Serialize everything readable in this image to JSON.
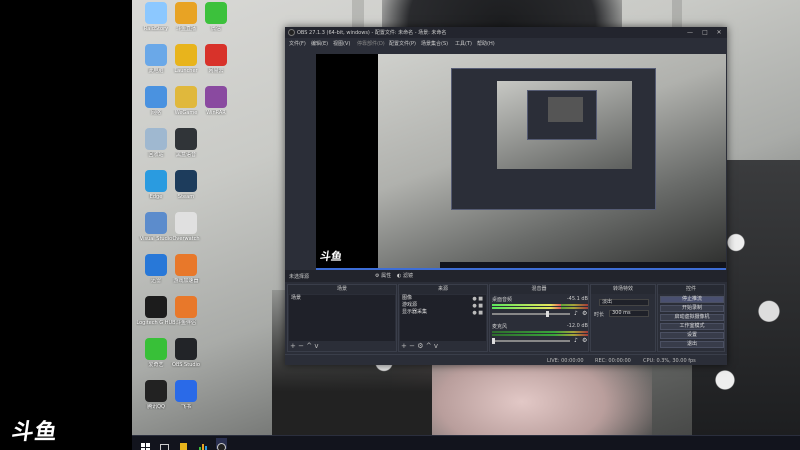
{
  "watermark": {
    "logo_text": "斗鱼"
  },
  "desktop": {
    "icons": [
      {
        "label": "RaidStory",
        "color": "#8cc8ff",
        "col": 0,
        "row": 0
      },
      {
        "label": "斗鱼直播",
        "color": "#e8a324",
        "col": 1,
        "row": 0
      },
      {
        "label": "微信",
        "color": "#3cc13c",
        "col": 2,
        "row": 0
      },
      {
        "label": "此电脑",
        "color": "#6aa8e8",
        "col": 0,
        "row": 1
      },
      {
        "label": "Launcher",
        "color": "#e8b41c",
        "col": 1,
        "row": 1
      },
      {
        "label": "网易云",
        "color": "#d8322a",
        "col": 2,
        "row": 1
      },
      {
        "label": "网络",
        "color": "#4a92e0",
        "col": 0,
        "row": 2
      },
      {
        "label": "WeGame",
        "color": "#e0b83c",
        "col": 1,
        "row": 2
      },
      {
        "label": "WinRAR",
        "color": "#8a4aa0",
        "col": 2,
        "row": 2
      },
      {
        "label": "回收站",
        "color": "#9fb8d0",
        "col": 0,
        "row": 3
      },
      {
        "label": "黑盒语音",
        "color": "#303438",
        "col": 1,
        "row": 3
      },
      {
        "label": "Edge",
        "color": "#2a9be0",
        "col": 0,
        "row": 4
      },
      {
        "label": "Steam",
        "color": "#1d3c5c",
        "col": 1,
        "row": 4
      },
      {
        "label": "Visual Studio",
        "color": "#5c8ccc",
        "col": 0,
        "row": 5
      },
      {
        "label": "Overwatch",
        "color": "#e0e0e0",
        "col": 1,
        "row": 5
      },
      {
        "label": "迅雷",
        "color": "#2878d8",
        "col": 0,
        "row": 6
      },
      {
        "label": "游戏加速器",
        "color": "#e8782a",
        "col": 1,
        "row": 6
      },
      {
        "label": "Logitech G HUB",
        "color": "#1c1c1c",
        "col": 0,
        "row": 7
      },
      {
        "label": "斗鱼伴侣",
        "color": "#e8782a",
        "col": 1,
        "row": 7
      },
      {
        "label": "爱奇艺",
        "color": "#38c038",
        "col": 0,
        "row": 8
      },
      {
        "label": "OBS Studio",
        "color": "#222428",
        "col": 1,
        "row": 8
      },
      {
        "label": "腾讯QQ",
        "color": "#222222",
        "col": 0,
        "row": 9
      },
      {
        "label": "飞书",
        "color": "#2a6ae8",
        "col": 1,
        "row": 9
      }
    ]
  },
  "taskbar": {
    "icons": [
      "windows-icon",
      "task-view-icon",
      "launcher-icon",
      "chart-icon",
      "obs-icon"
    ],
    "clock": ""
  },
  "obs": {
    "title": "OBS 27.1.3 (64-bit, windows) - 配置文件: 未命名 - 场景: 未命名",
    "window_buttons": {
      "minimize": "—",
      "maximize": "□",
      "close": "✕"
    },
    "menu": [
      "文件(F)",
      "编辑(E)",
      "视图(V)",
      "停靠部件(D)",
      "配置文件(P)",
      "场景集合(S)",
      "工具(T)",
      "帮助(H)"
    ],
    "preview_logo": "斗鱼",
    "scene_header": {
      "label": "未选择源",
      "properties": "属性",
      "filters": "滤镜"
    },
    "docks": {
      "scenes": {
        "title": "场景",
        "items": [
          "场景"
        ]
      },
      "sources": {
        "title": "来源",
        "items": [
          "图像",
          "游戏源",
          "显示器采集"
        ]
      },
      "mixer": {
        "title": "混音器",
        "tracks": [
          {
            "name": "桌面音频",
            "db": "-45.1 dB",
            "level": 0.72
          },
          {
            "name": "麦克风",
            "db": "-12.0 dB",
            "level": 0.8
          }
        ]
      },
      "transitions": {
        "title": "转场特效",
        "type": "淡出",
        "duration_label": "时长",
        "duration": "300 ms"
      },
      "controls": {
        "title": "控件",
        "buttons": [
          "停止推流",
          "开始录制",
          "启动虚拟摄像机",
          "工作室模式",
          "设置",
          "退出"
        ]
      }
    },
    "status": {
      "live": "LIVE: 00:00:00",
      "rec": "REC: 00:00:00",
      "cpu": "CPU: 0.3%, 30.00 fps"
    }
  }
}
